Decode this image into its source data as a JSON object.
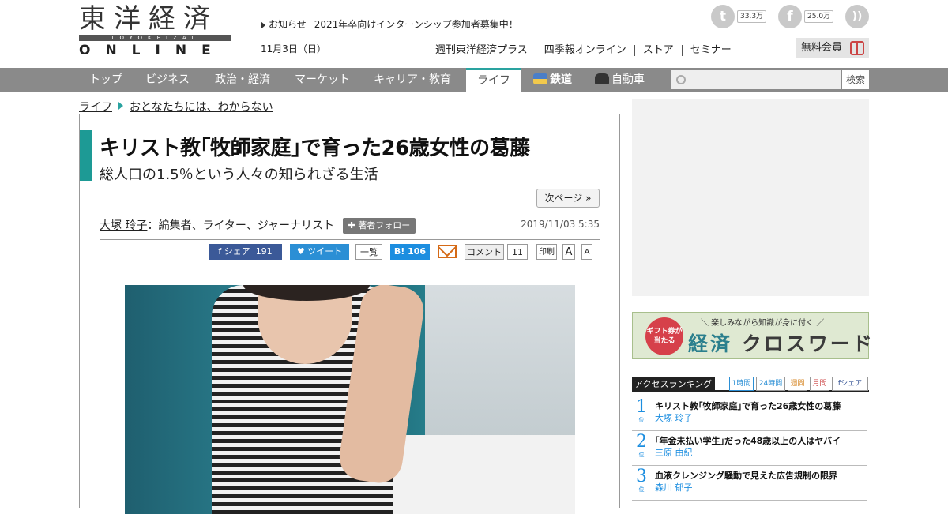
{
  "header": {
    "logo": {
      "kanji": "東洋経済",
      "band": "TOYOKEIZAI",
      "sub": "ONLINE"
    },
    "notice_label": "お知らせ",
    "notice_text": "2021年卒向けインターンシップ参加者募集中！",
    "date": "11月3日（日）",
    "social": {
      "twitter_count": "33.3万",
      "facebook_count": "25.0万"
    },
    "links": [
      "週刊東洋経済プラス",
      "四季報オンライン",
      "ストア",
      "セミナー"
    ],
    "member_label": "無料会員"
  },
  "nav": {
    "items": [
      "トップ",
      "ビジネス",
      "政治・経済",
      "マーケット",
      "キャリア・教育",
      "ライフ",
      "鉄道",
      "自動車"
    ],
    "active": "ライフ",
    "search_button": "検索"
  },
  "breadcrumb": [
    "ライフ",
    "おとなたちには、わからない"
  ],
  "article": {
    "title": "キリスト教｢牧師家庭｣で育った26歳女性の葛藤",
    "subtitle": "総人口の1.5％という人々の知られざる生活",
    "next_page": "次ページ »",
    "author": "大塚 玲子",
    "author_role": "：編集者、ライター、ジャーナリスト",
    "follow_label": "著者フォロー",
    "date": "2019/11/03 5:35",
    "share": {
      "facebook": "シェア",
      "facebook_count": "191",
      "tweet": "ツイート",
      "list": "一覧",
      "hatena_count": "106",
      "comment": "コメント",
      "comment_count": "11",
      "print": "印刷",
      "font_large": "A",
      "font_small": "A"
    }
  },
  "sidebar": {
    "banner": {
      "badge": "ギフト券が当たる",
      "catch": "＼ 楽しみながら知識が身に付く ／",
      "brand_a": "経済",
      "brand_b": "クロスワード"
    },
    "ranking": {
      "title": "アクセスランキング",
      "tabs": [
        "1時間",
        "24時間",
        "週間",
        "月間",
        "シェア"
      ],
      "rank_suffix": "位",
      "items": [
        {
          "rank": "1",
          "title": "キリスト教｢牧師家庭｣で育った26歳女性の葛藤",
          "author": "大塚 玲子"
        },
        {
          "rank": "2",
          "title": "｢年金未払い学生｣だった48歳以上の人はヤバイ",
          "author": "三原 由紀"
        },
        {
          "rank": "3",
          "title": "血液クレンジング騒動で見えた広告規制の限界",
          "author": "森川 郁子"
        }
      ]
    }
  },
  "colors": {
    "accent": "#1d9a95",
    "nav_bg": "#8a8a8a",
    "link_blue": "#1c8ee0",
    "facebook": "#3b5998",
    "twitter": "#2b8fd5"
  }
}
